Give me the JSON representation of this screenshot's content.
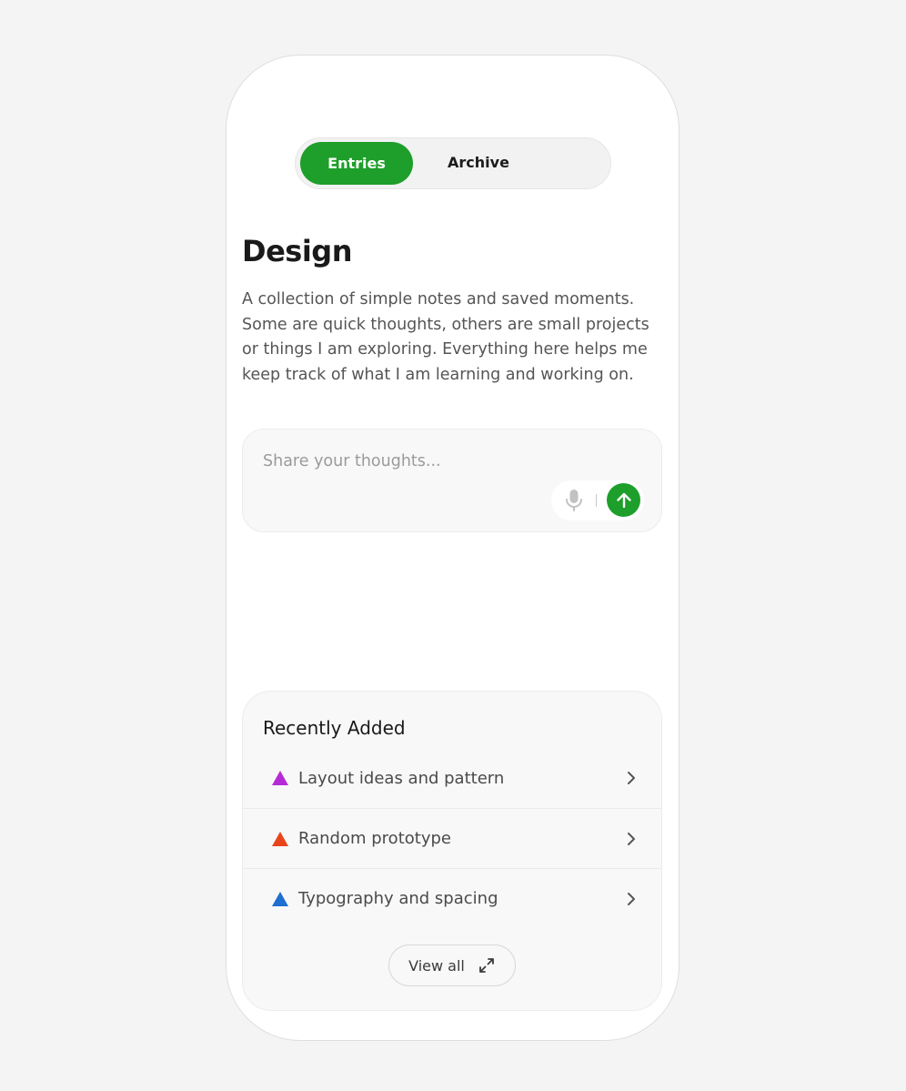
{
  "colors": {
    "accent": "#1e9e2a",
    "triangle_purple": "#b52cd6",
    "triangle_red": "#e8451c",
    "triangle_blue": "#1f6fd1"
  },
  "tabs": {
    "entries_label": "Entries",
    "archive_label": "Archive",
    "selected": "Entries"
  },
  "page": {
    "title": "Design",
    "description": "A collection of simple notes and saved moments. Some are quick thoughts, others are small projects or things I am exploring. Everything here helps me keep track of what I am learning and working on."
  },
  "composer": {
    "placeholder": "Share your thoughts...",
    "value": "",
    "mic_icon": "microphone-icon",
    "send_icon": "arrow-up-icon"
  },
  "recent": {
    "title": "Recently Added",
    "items": [
      {
        "label": "Layout ideas and pattern",
        "icon": "triangle-icon",
        "color": "#b52cd6"
      },
      {
        "label": "Random prototype",
        "icon": "triangle-icon",
        "color": "#e8451c"
      },
      {
        "label": "Typography and spacing",
        "icon": "triangle-icon",
        "color": "#1f6fd1"
      }
    ],
    "view_all_label": "View all",
    "view_all_icon": "expand-arrows-icon"
  }
}
